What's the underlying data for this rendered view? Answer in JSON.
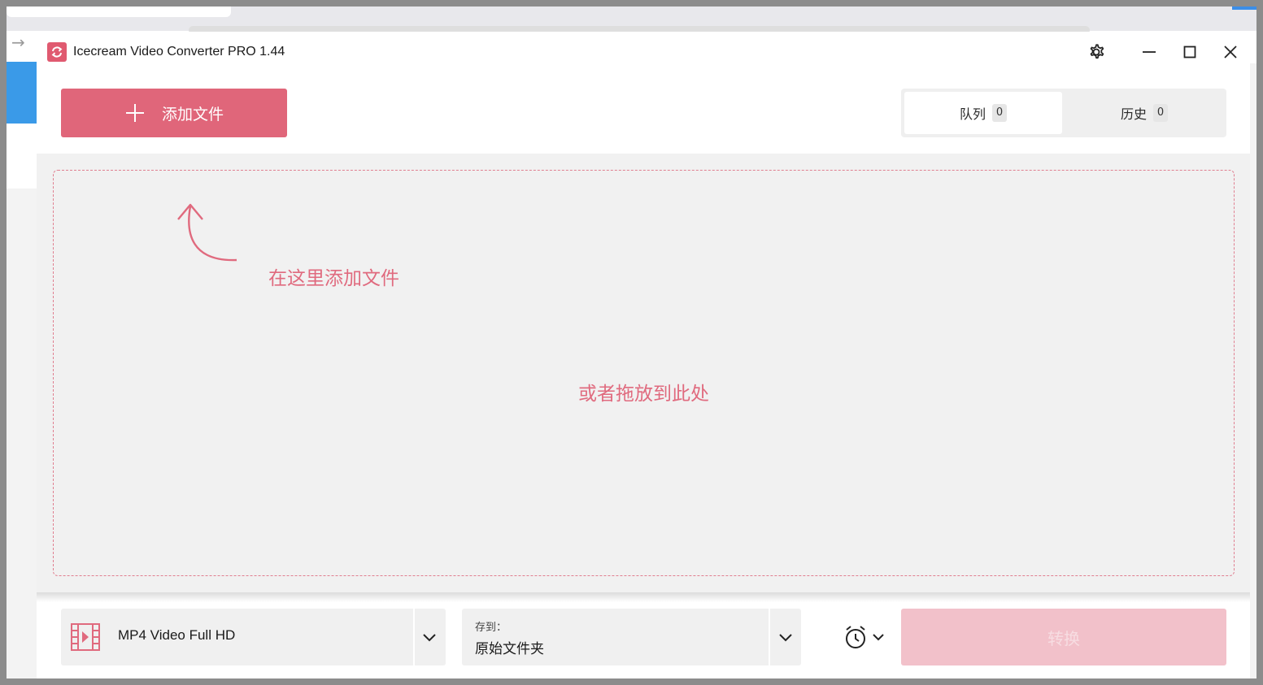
{
  "window": {
    "title": "Icecream Video Converter PRO 1.44"
  },
  "toolbar": {
    "add_files_label": "添加文件"
  },
  "tabs": [
    {
      "label": "队列",
      "count": "0",
      "active": true
    },
    {
      "label": "历史",
      "count": "0",
      "active": false
    }
  ],
  "drop_zone": {
    "hint_text": "在这里添加文件",
    "drop_text": "或者拖放到此处"
  },
  "bottom_bar": {
    "format_value": "MP4 Video Full HD",
    "save_to_caption": "存到：",
    "save_to_value": "原始文件夹",
    "convert_label": "转换"
  },
  "colors": {
    "accent": "#e0667a",
    "accent_disabled": "#f2c1ca",
    "drop_area_bg": "#f1f1f1"
  },
  "icons": [
    "app-logo-icon",
    "gear-icon",
    "minimize-icon",
    "maximize-icon",
    "close-icon",
    "plus-icon",
    "curved-arrow-icon",
    "film-icon",
    "chevron-down-icon",
    "alarm-clock-icon"
  ]
}
